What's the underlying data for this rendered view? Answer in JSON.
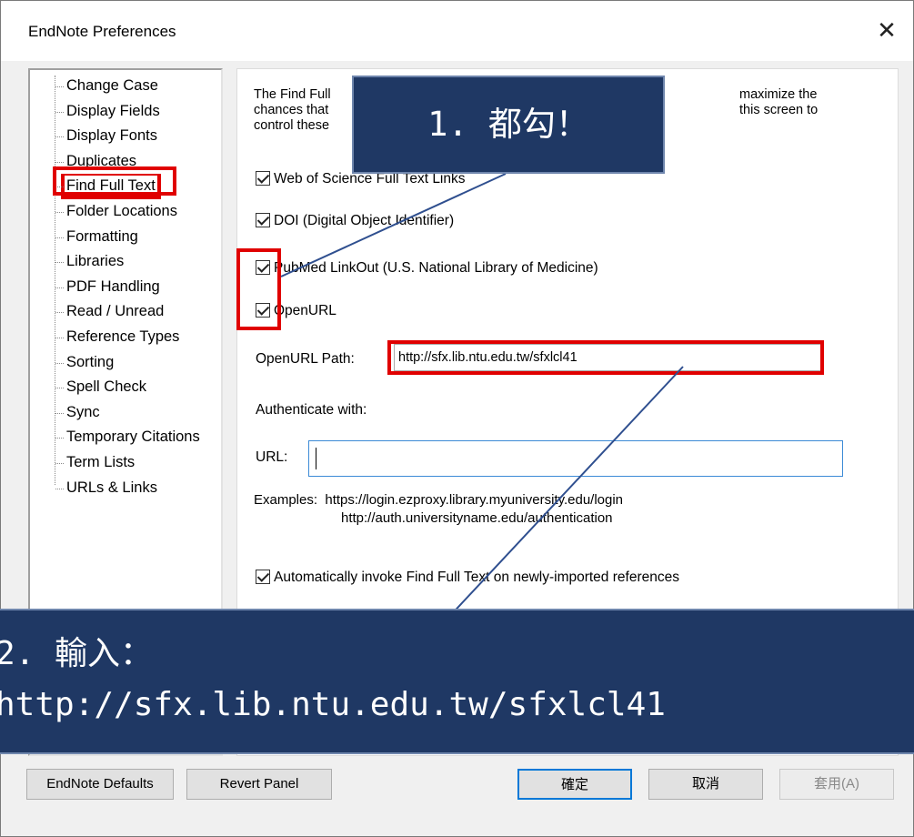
{
  "window": {
    "title": "EndNote Preferences",
    "close_glyph": "✕"
  },
  "tree": {
    "items": [
      "Change Case",
      "Display Fields",
      "Display Fonts",
      "Duplicates",
      "Find Full Text",
      "Folder Locations",
      "Formatting",
      "Libraries",
      "PDF Handling",
      "Read / Unread",
      "Reference Types",
      "Sorting",
      "Spell Check",
      "Sync",
      "Temporary Citations",
      "Term Lists",
      "URLs & Links"
    ],
    "selected": "Find Full Text",
    "scroll_left": "<",
    "scroll_right": ">"
  },
  "panel": {
    "intro_lines": [
      "The Find Full",
      "chances that",
      "control these"
    ],
    "intro_right_lines": [
      "maximize the",
      "this screen to"
    ],
    "checkboxes": {
      "web_of_science": "Web of Science Full Text Links",
      "doi": "DOI (Digital Object Identifier)",
      "pubmed": "PubMed LinkOut (U.S. National Library of Medicine)",
      "openurl": "OpenURL",
      "auto_invoke": "Automatically invoke Find Full Text on newly-imported references"
    },
    "openurl_path_label": "OpenURL Path:",
    "openurl_path_value": "http://sfx.lib.ntu.edu.tw/sfxlcl41",
    "authenticate_label": "Authenticate with:",
    "url_label": "URL:",
    "url_value": "",
    "examples_label": "Examples:",
    "example_1": "https://login.ezproxy.library.myuniversity.edu/login",
    "example_2": "http://auth.universityname.edu/authentication"
  },
  "annotations": {
    "callout_1": "1. 都勾！",
    "callout_2_line1": "2. 輸入：",
    "callout_2_line2": "http://sfx.lib.ntu.edu.tw/sfxlcl41",
    "color": "#1f3864",
    "highlight_color": "#e00000"
  },
  "buttons": {
    "endnote_defaults": "EndNote Defaults",
    "revert_panel": "Revert Panel",
    "ok": "確定",
    "cancel": "取消",
    "apply": "套用(A)"
  }
}
